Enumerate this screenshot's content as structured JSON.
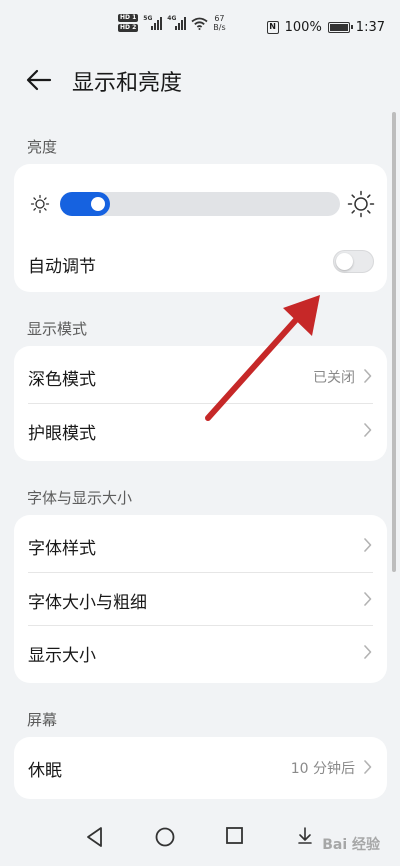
{
  "status_bar": {
    "hd1": "HD 1",
    "hd2": "HD 2",
    "sig1_gen": "5G",
    "sig2_gen": "4G",
    "net_speed_value": "67",
    "net_speed_unit": "B/s",
    "battery_percent": "100%",
    "time": "1:37",
    "icons": [
      "signal-icon",
      "wifi-icon",
      "nfc-icon",
      "battery-icon"
    ]
  },
  "header": {
    "title": "显示和亮度",
    "back_icon": "back-arrow-icon"
  },
  "sections": {
    "brightness": {
      "title": "亮度",
      "slider_level": 0.18,
      "auto_label": "自动调节",
      "auto_enabled": false
    },
    "display_mode": {
      "title": "显示模式",
      "dark_mode_label": "深色模式",
      "dark_mode_value": "已关闭",
      "eye_mode_label": "护眼模式"
    },
    "font": {
      "title": "字体与显示大小",
      "font_style_label": "字体样式",
      "font_size_label": "字体大小与粗细",
      "display_size_label": "显示大小"
    },
    "screen": {
      "title": "屏幕",
      "sleep_label": "休眠",
      "sleep_value": "10 分钟后"
    }
  },
  "navbar": {
    "icons": [
      "nav-back-icon",
      "nav-home-icon",
      "nav-recents-icon",
      "nav-download-icon"
    ]
  },
  "watermark": "Bai 经验",
  "colors": {
    "accent": "#1662e0",
    "background": "#f1f3f5",
    "card": "#ffffff",
    "annotation_arrow": "#c62828"
  }
}
